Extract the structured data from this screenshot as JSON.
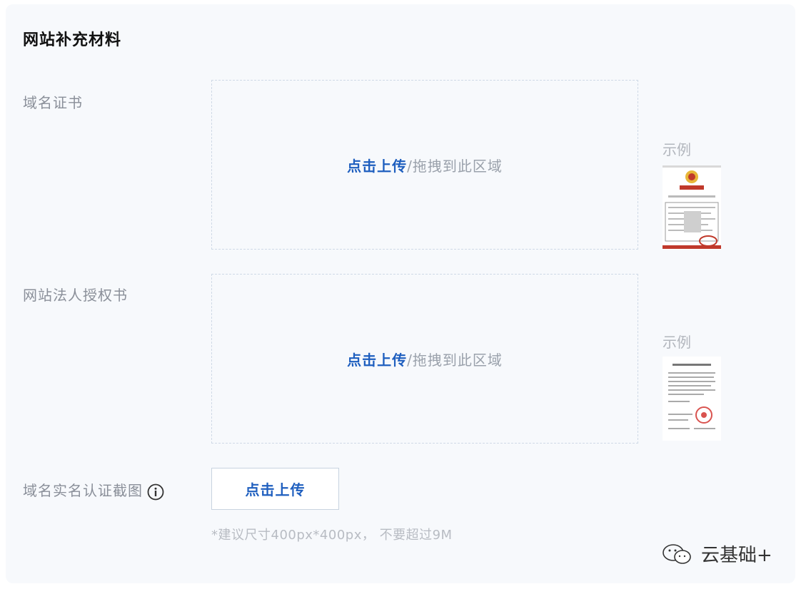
{
  "section": {
    "title": "网站补充材料"
  },
  "fields": [
    {
      "label": "域名证书",
      "upload_link": "点击上传",
      "upload_hint": "/拖拽到此区域",
      "example_label": "示例"
    },
    {
      "label": "网站法人授权书",
      "upload_link": "点击上传",
      "upload_hint": "/拖拽到此区域",
      "example_label": "示例"
    }
  ],
  "realname": {
    "label": "域名实名认证截图",
    "button_label": "点击上传",
    "note": "*建议尺寸400px*400px， 不要超过9M"
  },
  "watermark": {
    "text": "云基础+"
  },
  "icons": {
    "info": "info-icon",
    "certificate_thumbnail": "certificate-thumbnail",
    "authorization_thumbnail": "authorization-letter-thumbnail",
    "watermark_logo": "wechat-logo-icon"
  },
  "colors": {
    "link": "#1f5fbf",
    "label": "#8a8f99",
    "border_dashed": "#cfd9e6",
    "background": "#f7f9fc"
  }
}
